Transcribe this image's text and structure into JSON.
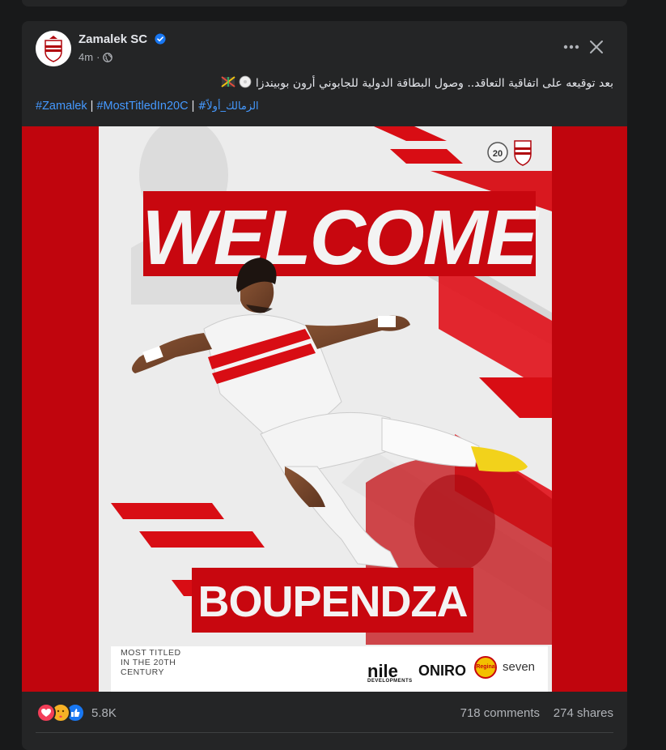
{
  "post": {
    "author": "Zamalek SC",
    "time": "4m",
    "privacy_icon": "globe-icon",
    "verified": true,
    "text": "بعد توقيعه على اتفاقية التعاقد.. وصول البطاقة الدولية للجابوني أرون بوبيندزا",
    "hashtags": [
      "#Zamalek",
      "#MostTitledIn20C",
      "#الزمالك_أولاً"
    ],
    "separator": "|"
  },
  "poster": {
    "headline": "WELCOME",
    "player_name": "BOUPENDZA",
    "badge_number": "20",
    "footer_claim": "MOST TITLED\nIN THE 20TH\nCENTURY",
    "sponsors": [
      "nile",
      "ONIRO",
      "Regina",
      "seven"
    ],
    "sponsor_sub": "DEVELOPMENTS"
  },
  "engagement": {
    "reaction_count": "5.8K",
    "comments": "718 comments",
    "shares": "274 shares",
    "reactions": [
      "love",
      "care",
      "like"
    ]
  },
  "colors": {
    "background": "#18191a",
    "card": "#242526",
    "link": "#4599ff",
    "verified": "#1877f2",
    "poster_red": "#c0050d",
    "love": "#f33e58",
    "care": "#f7b125",
    "like": "#1877f2"
  }
}
